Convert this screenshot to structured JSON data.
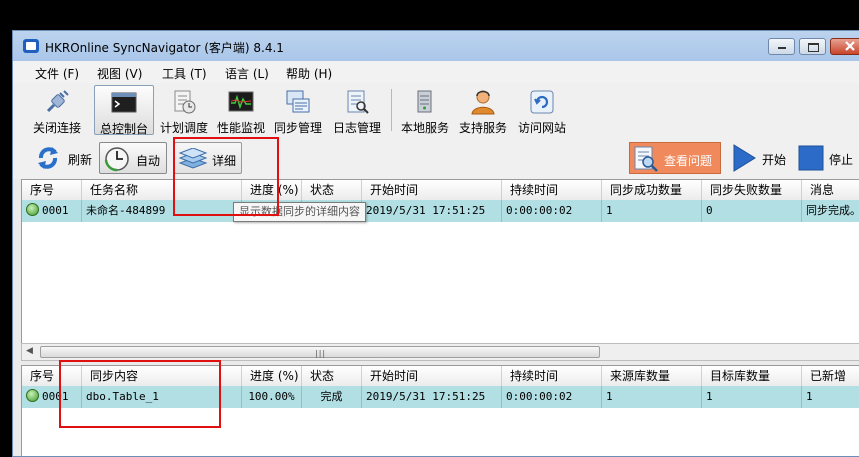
{
  "window": {
    "title": "HKROnline SyncNavigator (客户端) 8.4.1"
  },
  "menu": [
    "文件 (F)",
    "视图 (V)",
    "工具 (T)",
    "语言 (L)",
    "帮助 (H)"
  ],
  "toolbar": [
    "关闭连接",
    "总控制台",
    "计划调度",
    "性能监视",
    "同步管理",
    "日志管理",
    "本地服务",
    "支持服务",
    "访问网站"
  ],
  "actions": {
    "refresh": "刷新",
    "auto": "自动",
    "detail": "详细",
    "view_issues": "查看问题",
    "start": "开始",
    "stop": "停止"
  },
  "tooltip": "显示数据同步的详细内容",
  "tasks": {
    "columns": [
      "序号",
      "任务名称",
      "进度 (%)",
      "状态",
      "开始时间",
      "持续时间",
      "同步成功数量",
      "同步失败数量",
      "消息"
    ],
    "rows": [
      [
        "0001",
        "未命名-484899",
        "",
        "",
        "2019/5/31 17:51:25",
        "0:00:00:02",
        "1",
        "0",
        "同步完成。"
      ]
    ]
  },
  "details": {
    "columns": [
      "序号",
      "同步内容",
      "进度 (%)",
      "状态",
      "开始时间",
      "持续时间",
      "来源库数量",
      "目标库数量",
      "已新增"
    ],
    "rows": [
      [
        "0001",
        "dbo.Table_1",
        "100.00%",
        "完成",
        "2019/5/31 17:51:25",
        "0:00:00:02",
        "1",
        "1",
        "1"
      ]
    ]
  },
  "colors": {
    "titlebar": "#a9c6e9",
    "row_selected": "#b2dfe4",
    "highlight_box": "#e01010",
    "view_issues_bg": "#f08a5d"
  }
}
